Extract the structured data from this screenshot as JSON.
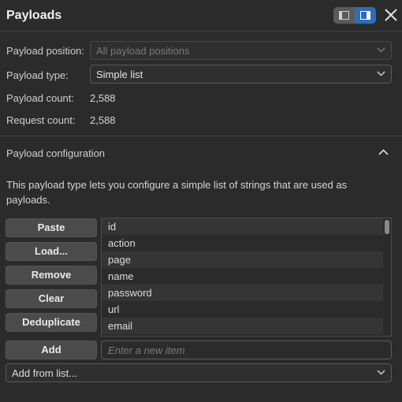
{
  "header": {
    "title": "Payloads",
    "toggle_left_icon": "sidebar-left-icon",
    "toggle_right_icon": "sidebar-right-icon",
    "close_icon": "close-icon",
    "accent_color": "#2d6dbb"
  },
  "fields": {
    "position_label": "Payload position:",
    "position_value": "All payload positions",
    "type_label": "Payload type:",
    "type_value": "Simple list",
    "payload_count_label": "Payload count:",
    "payload_count_value": "2,588",
    "request_count_label": "Request count:",
    "request_count_value": "2,588"
  },
  "config": {
    "title": "Payload configuration",
    "collapse_icon": "chevron-up-icon",
    "description": "This payload type lets you configure a simple list of strings that are used as payloads.",
    "buttons": {
      "paste": "Paste",
      "load": "Load...",
      "remove": "Remove",
      "clear": "Clear",
      "deduplicate": "Deduplicate",
      "add": "Add"
    },
    "list_items": [
      "id",
      "action",
      "page",
      "name",
      "password",
      "url",
      "email"
    ],
    "new_item_placeholder": "Enter a new item",
    "add_from_list": "Add from list..."
  }
}
